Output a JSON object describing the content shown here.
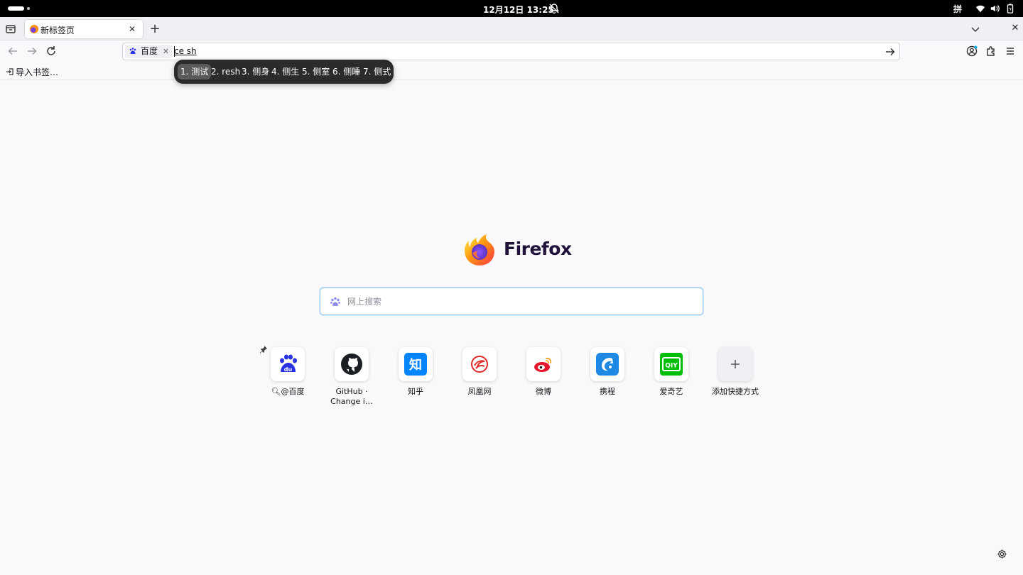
{
  "system_bar": {
    "clock": "12月12日  13:25",
    "input_method": "拼"
  },
  "tabs": [
    {
      "title": "新标签页",
      "close": "✕"
    }
  ],
  "tabstrip": {
    "new_tab": "+",
    "window_close": "✕"
  },
  "urlbar": {
    "search_engine": "百度",
    "chip_close": "✕",
    "typed_text": "ce sh"
  },
  "bookmarks_toolbar": {
    "import_label": "导入书签…"
  },
  "ime_candidates": [
    {
      "label": "1. 测试",
      "selected": true
    },
    {
      "label": "2. resh",
      "selected": false
    },
    {
      "label": "3. 侧身",
      "selected": false
    },
    {
      "label": "4. 侧生",
      "selected": false
    },
    {
      "label": "5. 侧室",
      "selected": false
    },
    {
      "label": "6. 侧睡",
      "selected": false
    },
    {
      "label": "7. 侧式",
      "selected": false
    }
  ],
  "newtab": {
    "brand": "Firefox",
    "search_placeholder": "网上搜索",
    "shortcuts": [
      {
        "label": "@百度",
        "icon": "baidu-icon"
      },
      {
        "label": "GitHub · Change i…",
        "icon": "github-icon"
      },
      {
        "label": "知乎",
        "icon": "zhihu-icon"
      },
      {
        "label": "凤凰网",
        "icon": "ifeng-icon"
      },
      {
        "label": "微博",
        "icon": "weibo-icon"
      },
      {
        "label": "携程",
        "icon": "ctrip-icon"
      },
      {
        "label": "爱奇艺",
        "icon": "iqiyi-icon"
      },
      {
        "label": "添加快捷方式",
        "icon": "plus-icon"
      }
    ]
  },
  "colors": {
    "accent": "#0061e0",
    "baidu_blue": "#2932e1",
    "zhihu_blue": "#0084ff",
    "weibo_red": "#e6162d",
    "iqiyi_green": "#00be06"
  }
}
